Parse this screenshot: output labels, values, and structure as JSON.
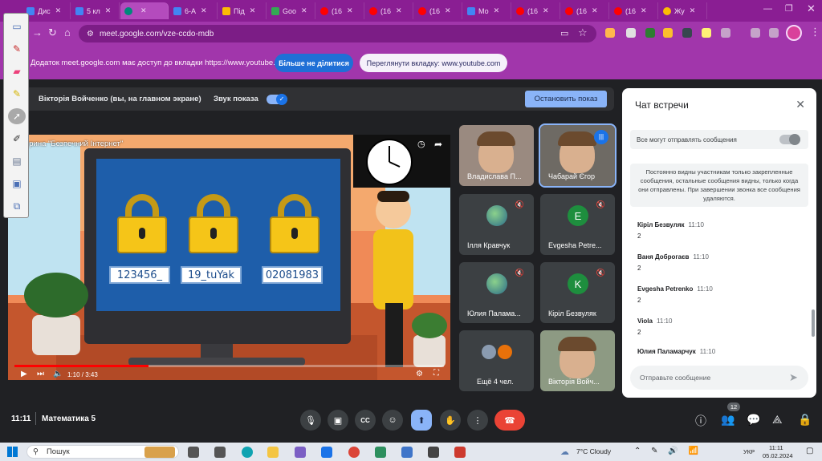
{
  "tabs": [
    {
      "label": "Дис",
      "icon": "docs-icon",
      "color": "#4285f4"
    },
    {
      "label": "5 кл",
      "icon": "docs-icon",
      "color": "#4285f4"
    },
    {
      "label": "",
      "icon": "meet-icon",
      "color": "#00897b",
      "active": true
    },
    {
      "label": "6-А",
      "icon": "docs-icon",
      "color": "#4285f4"
    },
    {
      "label": "Під",
      "icon": "folder-icon",
      "color": "#fbbc04"
    },
    {
      "label": "Goo",
      "icon": "google-icon",
      "color": "#34a853"
    },
    {
      "label": "(16",
      "icon": "youtube-icon",
      "color": "#ff0000"
    },
    {
      "label": "(16",
      "icon": "youtube-icon",
      "color": "#ff0000"
    },
    {
      "label": "(16",
      "icon": "youtube-icon",
      "color": "#ff0000"
    },
    {
      "label": "Мо",
      "icon": "docs-icon",
      "color": "#4285f4"
    },
    {
      "label": "(16",
      "icon": "youtube-icon",
      "color": "#ff0000"
    },
    {
      "label": "(16",
      "icon": "youtube-icon",
      "color": "#ff0000"
    },
    {
      "label": "(16",
      "icon": "youtube-icon",
      "color": "#ff0000"
    },
    {
      "label": "Жу",
      "icon": "sun-icon",
      "color": "#fbbc04"
    }
  ],
  "address": {
    "url": "meet.google.com/vze-ccdo-mdb"
  },
  "infobar": {
    "text": "Додаток meet.google.com має доступ до вкладки https://www.youtube.com",
    "stop_sharing": "Більше не ділитися",
    "view_tab": "Переглянути вкладку: www.youtube.com"
  },
  "presenter": {
    "name": "Вікторія Войченко (вы, на главном экране)",
    "sound_label": "Звук показа",
    "stop_button": "Остановить показ"
  },
  "video": {
    "title": "Вікторина \"Безпечний Інтернет\"",
    "passwords": [
      "123456_",
      "19_tuYak",
      "02081983"
    ],
    "time": "1:10 / 3:43",
    "progress": 0.313
  },
  "participants": [
    {
      "name": "Владислава П...",
      "type": "camera"
    },
    {
      "name": "Чабарай Єгор",
      "type": "camera",
      "speaking": true
    },
    {
      "name": "Ілля Кравчук",
      "type": "photo",
      "muted": true
    },
    {
      "name": "Evgesha Petre...",
      "type": "letter",
      "letter": "E",
      "color": "#1e8e3e",
      "muted": true
    },
    {
      "name": "Юлия Палама...",
      "type": "photo",
      "muted": true
    },
    {
      "name": "Кірiл Безвуляк",
      "type": "letter",
      "letter": "K",
      "color": "#1e8e3e",
      "muted": true
    },
    {
      "name": "Ещё 4 чел.",
      "type": "more"
    },
    {
      "name": "Вікторія Войч...",
      "type": "camera"
    }
  ],
  "chat": {
    "title": "Чат встречи",
    "setting": "Все могут отправлять сообщения",
    "note": "Постоянно видны участникам только закрепленные сообщения, остальные сообщения видны, только когда они отправлены. При завершении звонка все сообщения удаляются.",
    "messages": [
      {
        "name": "Кірiл Безвуляк",
        "time": "11:10",
        "text": "2"
      },
      {
        "name": "Ваня Доброгаєв",
        "time": "11:10",
        "text": "2"
      },
      {
        "name": "Evgesha Petrenko",
        "time": "11:10",
        "text": "2"
      },
      {
        "name": "Viola",
        "time": "11:10",
        "text": "2"
      },
      {
        "name": "Юлия Паламарчук",
        "time": "11:10",
        "text": ""
      }
    ],
    "input_placeholder": "Отправьте сообщение"
  },
  "footer": {
    "time": "11:11",
    "meeting": "Математика 5",
    "participants_badge": "12"
  },
  "taskbar": {
    "search": "Пошук",
    "weather": "7°C Cloudy",
    "lang": "УКР",
    "clock_time": "11:11",
    "clock_date": "05.02.2024"
  },
  "colors": {
    "tab_bg": "#8a1e93",
    "toolbar_bg": "#a136ab",
    "meet_bg": "#202124",
    "accent": "#8ab4f8",
    "end_call": "#ea4335"
  }
}
